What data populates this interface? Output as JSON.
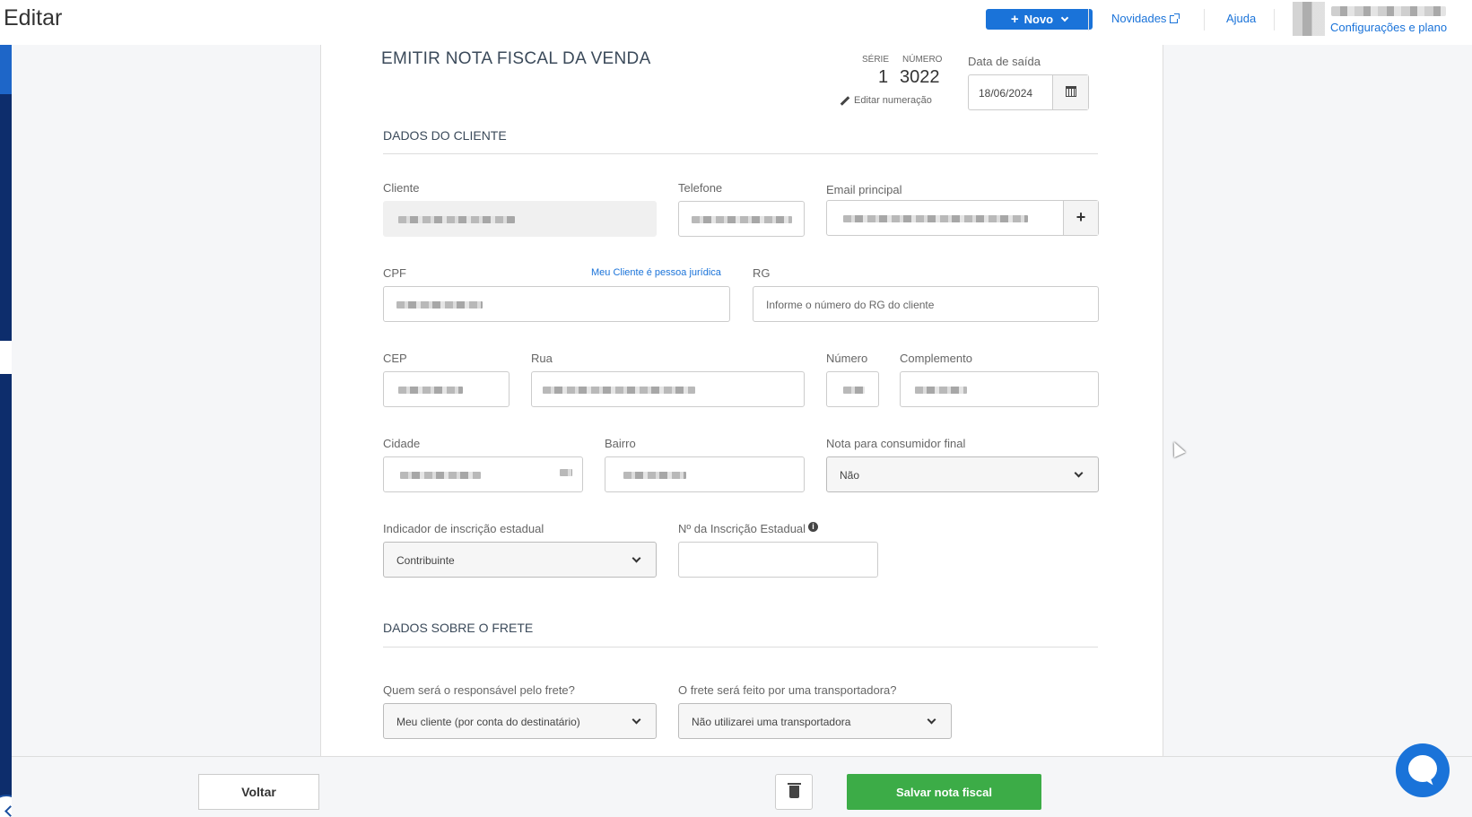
{
  "header": {
    "title": "Editar",
    "novo_button": "Novo",
    "novidades_link": "Novidades",
    "ajuda_link": "Ajuda",
    "config_link": "Configurações e plano"
  },
  "form": {
    "title": "EMITIR NOTA FISCAL DA VENDA",
    "serie_label": "SÉRIE",
    "serie_value": "1",
    "numero_label": "NÚMERO",
    "numero_value": "3022",
    "edit_numbering": "Editar numeração",
    "date_label": "Data de saída",
    "date_value": "18/06/2024"
  },
  "cliente_section": {
    "title": "DADOS DO CLIENTE",
    "cliente_label": "Cliente",
    "telefone_label": "Telefone",
    "email_label": "Email principal",
    "email_add": "+",
    "cpf_label": "CPF",
    "pj_link": "Meu Cliente é pessoa jurídica",
    "rg_label": "RG",
    "rg_placeholder": "Informe o número do RG do cliente",
    "cep_label": "CEP",
    "rua_label": "Rua",
    "numero_label": "Número",
    "complemento_label": "Complemento",
    "cidade_label": "Cidade",
    "bairro_label": "Bairro",
    "consumidor_label": "Nota para consumidor final",
    "consumidor_value": "Não",
    "indicador_label": "Indicador de inscrição estadual",
    "indicador_value": "Contribuinte",
    "inscricao_label": "Nº da Inscrição Estadual",
    "inscricao_info": "i"
  },
  "frete_section": {
    "title": "DADOS SOBRE O FRETE",
    "responsavel_label": "Quem será o responsável pelo frete?",
    "responsavel_value": "Meu cliente (por conta do destinatário)",
    "transportadora_label": "O frete será feito por uma transportadora?",
    "transportadora_value": "Não utilizarei uma transportadora"
  },
  "footer": {
    "voltar": "Voltar",
    "salvar": "Salvar nota fiscal"
  }
}
